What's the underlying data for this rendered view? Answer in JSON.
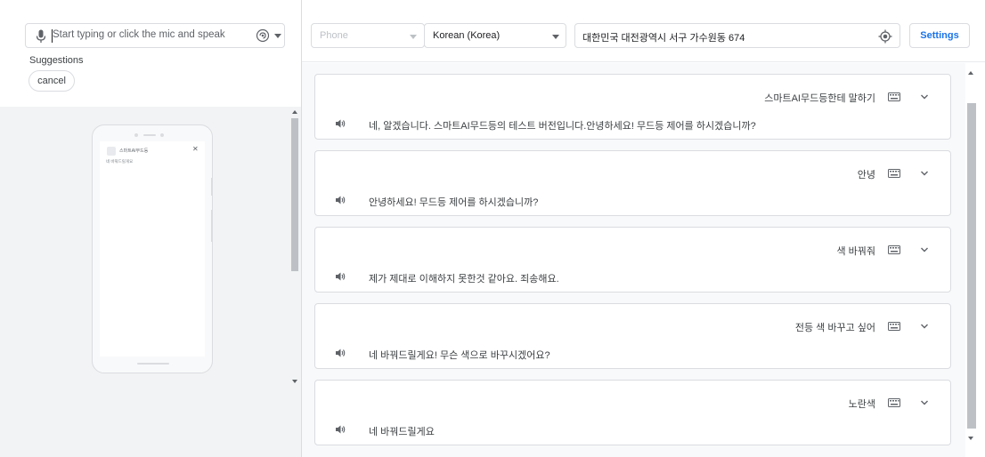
{
  "input": {
    "placeholder": "Start typing or click the mic and speak"
  },
  "suggestions": {
    "title": "Suggestions",
    "chips": [
      {
        "label": "cancel"
      }
    ]
  },
  "phone_preview": {
    "app_title": "스마트AI무드등",
    "app_text": "네 바꿔드릴게요"
  },
  "topbar": {
    "device": "Phone",
    "language": "Korean (Korea)",
    "location": "대한민국 대전광역시 서구 가수원동 674",
    "settings_label": "Settings"
  },
  "conversation": [
    {
      "user": "스마트AI무드등한테 말하기",
      "bot": "네, 알겠습니다. 스마트AI무드등의 테스트 버전입니다.안녕하세요! 무드등 제어를 하시겠습니까?"
    },
    {
      "user": "안녕",
      "bot": "안녕하세요! 무드등 제어를 하시겠습니까?"
    },
    {
      "user": "색 바꿔줘",
      "bot": "제가 제대로 이해하지 못한것 같아요. 죄송해요."
    },
    {
      "user": "전등 색 바꾸고 싶어",
      "bot": "네 바꿔드릴게요! 무슨 색으로 바꾸시겠어요?"
    },
    {
      "user": "노란색",
      "bot": "네 바꿔드릴게요"
    }
  ],
  "colors": {
    "accent": "#1a73e8",
    "border": "#dadce0",
    "panel_bg": "#f1f3f4",
    "conv_bg": "#f8f9fa"
  },
  "icons": {
    "mic": "mic-icon",
    "voice_select": "voice-icon",
    "location": "my-location-icon",
    "keyboard": "keyboard-icon",
    "expand": "chevron-down-icon",
    "speaker": "speaker-icon"
  }
}
